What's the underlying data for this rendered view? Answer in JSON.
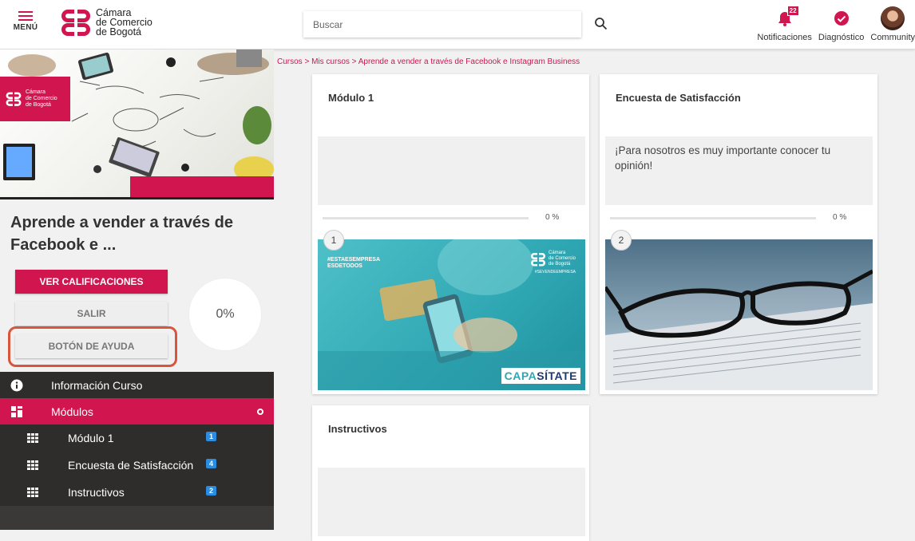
{
  "header": {
    "menu_label": "MENÚ",
    "logo_lines": [
      "Cámara",
      "de Comercio",
      "de Bogotá"
    ],
    "search_placeholder": "Buscar",
    "actions": [
      {
        "label": "Notificaciones",
        "icon": "bell-icon",
        "badge": "22"
      },
      {
        "label": "Diagnóstico",
        "icon": "check-circle-icon"
      },
      {
        "label": "Community",
        "icon": "avatar"
      }
    ]
  },
  "hero": {
    "badge_lines": [
      "Cámara",
      "de Comercio",
      "de Bogotá"
    ]
  },
  "course": {
    "title": "Aprende a vender a través de Facebook e ...",
    "progress": "0%"
  },
  "buttons": {
    "grades": "VER CALIFICACIONES",
    "exit": "SALIR",
    "help": "BOTÓN DE AYUDA"
  },
  "nav": {
    "info": "Información Curso",
    "modules": "Módulos",
    "items": [
      {
        "label": "Módulo 1",
        "count": "1"
      },
      {
        "label": "Encuesta de Satisfacción",
        "count": "4"
      },
      {
        "label": "Instructivos",
        "count": "2"
      }
    ]
  },
  "breadcrumb": {
    "items": [
      "Cursos",
      "Mis cursos",
      "Aprende a vender a través de Facebook e Instagram Business"
    ],
    "separator": " > "
  },
  "cards": [
    {
      "title": "Módulo 1",
      "description": "",
      "progress": "0 %",
      "number": "1",
      "image_texts": [
        "#ESTAESEMPRESA",
        "ESDETODOS",
        "Cámara",
        "de Comercio",
        "de Bogotá",
        "#SEVENDEEMPRESA",
        "CAPA",
        "SÍTATE"
      ]
    },
    {
      "title": "Encuesta de Satisfacción",
      "description": "¡Para nosotros es muy importante conocer tu opinión!",
      "progress": "0 %",
      "number": "2"
    },
    {
      "title": "Instructivos"
    }
  ],
  "colors": {
    "brand": "#d0154f",
    "sidebar_dark": "#2f2c2c",
    "count_badge": "#2a8de0",
    "help_highlight": "#d9553c"
  }
}
